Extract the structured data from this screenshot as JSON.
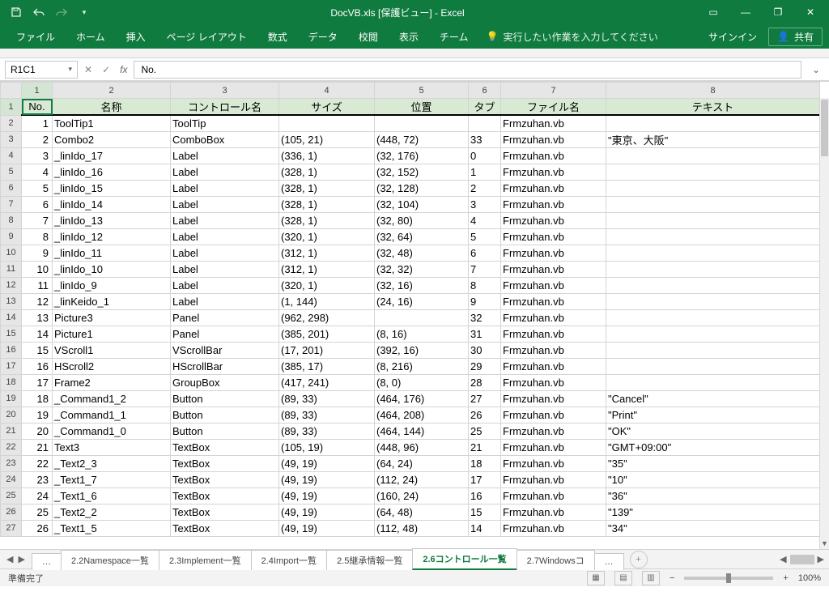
{
  "title": "DocVB.xls  [保護ビュー] - Excel",
  "qat": {
    "save": "save-icon",
    "undo": "undo-icon",
    "redo": "redo-icon",
    "customize": "▾"
  },
  "win": {
    "ribbon_opts": "▭",
    "min": "—",
    "restore": "❐",
    "close": "✕"
  },
  "ribbon": {
    "tabs": [
      "ファイル",
      "ホーム",
      "挿入",
      "ページ レイアウト",
      "数式",
      "データ",
      "校閲",
      "表示",
      "チーム"
    ],
    "tell_me": "実行したい作業を入力してください",
    "signin": "サインイン",
    "share": "共有"
  },
  "namebox": "R1C1",
  "formula": "No.",
  "columns": {
    "letters": [
      "1",
      "2",
      "3",
      "4",
      "5",
      "6",
      "7",
      "8"
    ],
    "headers": [
      "No.",
      "名称",
      "コントロール名",
      "サイズ",
      "位置",
      "タブ",
      "ファイル名",
      "テキスト"
    ]
  },
  "rows": [
    {
      "r": 2,
      "no": "1",
      "name": "ToolTip1",
      "ctrl": "ToolTip",
      "size": "",
      "pos": "",
      "tab": "",
      "file": "Frmzuhan.vb",
      "text": ""
    },
    {
      "r": 3,
      "no": "2",
      "name": "Combo2",
      "ctrl": "ComboBox",
      "size": "(105, 21)",
      "pos": "(448, 72)",
      "tab": "33",
      "file": "Frmzuhan.vb",
      "text": "\"東京、大阪\""
    },
    {
      "r": 4,
      "no": "3",
      "name": "_linIdo_17",
      "ctrl": "Label",
      "size": "(336, 1)",
      "pos": "(32, 176)",
      "tab": "0",
      "file": "Frmzuhan.vb",
      "text": ""
    },
    {
      "r": 5,
      "no": "4",
      "name": "_linIdo_16",
      "ctrl": "Label",
      "size": "(328, 1)",
      "pos": "(32, 152)",
      "tab": "1",
      "file": "Frmzuhan.vb",
      "text": ""
    },
    {
      "r": 6,
      "no": "5",
      "name": "_linIdo_15",
      "ctrl": "Label",
      "size": "(328, 1)",
      "pos": "(32, 128)",
      "tab": "2",
      "file": "Frmzuhan.vb",
      "text": ""
    },
    {
      "r": 7,
      "no": "6",
      "name": "_linIdo_14",
      "ctrl": "Label",
      "size": "(328, 1)",
      "pos": "(32, 104)",
      "tab": "3",
      "file": "Frmzuhan.vb",
      "text": ""
    },
    {
      "r": 8,
      "no": "7",
      "name": "_linIdo_13",
      "ctrl": "Label",
      "size": "(328, 1)",
      "pos": "(32, 80)",
      "tab": "4",
      "file": "Frmzuhan.vb",
      "text": ""
    },
    {
      "r": 9,
      "no": "8",
      "name": "_linIdo_12",
      "ctrl": "Label",
      "size": "(320, 1)",
      "pos": "(32, 64)",
      "tab": "5",
      "file": "Frmzuhan.vb",
      "text": ""
    },
    {
      "r": 10,
      "no": "9",
      "name": "_linIdo_11",
      "ctrl": "Label",
      "size": "(312, 1)",
      "pos": "(32, 48)",
      "tab": "6",
      "file": "Frmzuhan.vb",
      "text": ""
    },
    {
      "r": 11,
      "no": "10",
      "name": "_linIdo_10",
      "ctrl": "Label",
      "size": "(312, 1)",
      "pos": "(32, 32)",
      "tab": "7",
      "file": "Frmzuhan.vb",
      "text": ""
    },
    {
      "r": 12,
      "no": "11",
      "name": "_linIdo_9",
      "ctrl": "Label",
      "size": "(320, 1)",
      "pos": "(32, 16)",
      "tab": "8",
      "file": "Frmzuhan.vb",
      "text": ""
    },
    {
      "r": 13,
      "no": "12",
      "name": "_linKeido_1",
      "ctrl": "Label",
      "size": "(1, 144)",
      "pos": "(24, 16)",
      "tab": "9",
      "file": "Frmzuhan.vb",
      "text": ""
    },
    {
      "r": 14,
      "no": "13",
      "name": "Picture3",
      "ctrl": "Panel",
      "size": "(962, 298)",
      "pos": "",
      "tab": "32",
      "file": "Frmzuhan.vb",
      "text": ""
    },
    {
      "r": 15,
      "no": "14",
      "name": "Picture1",
      "ctrl": "Panel",
      "size": "(385, 201)",
      "pos": "(8, 16)",
      "tab": "31",
      "file": "Frmzuhan.vb",
      "text": ""
    },
    {
      "r": 16,
      "no": "15",
      "name": "VScroll1",
      "ctrl": "VScrollBar",
      "size": "(17, 201)",
      "pos": "(392, 16)",
      "tab": "30",
      "file": "Frmzuhan.vb",
      "text": ""
    },
    {
      "r": 17,
      "no": "16",
      "name": "HScroll2",
      "ctrl": "HScrollBar",
      "size": "(385, 17)",
      "pos": "(8, 216)",
      "tab": "29",
      "file": "Frmzuhan.vb",
      "text": ""
    },
    {
      "r": 18,
      "no": "17",
      "name": "Frame2",
      "ctrl": "GroupBox",
      "size": "(417, 241)",
      "pos": "(8, 0)",
      "tab": "28",
      "file": "Frmzuhan.vb",
      "text": ""
    },
    {
      "r": 19,
      "no": "18",
      "name": "_Command1_2",
      "ctrl": "Button",
      "size": "(89, 33)",
      "pos": "(464, 176)",
      "tab": "27",
      "file": "Frmzuhan.vb",
      "text": "\"Cancel\""
    },
    {
      "r": 20,
      "no": "19",
      "name": "_Command1_1",
      "ctrl": "Button",
      "size": "(89, 33)",
      "pos": "(464, 208)",
      "tab": "26",
      "file": "Frmzuhan.vb",
      "text": "\"Print\""
    },
    {
      "r": 21,
      "no": "20",
      "name": "_Command1_0",
      "ctrl": "Button",
      "size": "(89, 33)",
      "pos": "(464, 144)",
      "tab": "25",
      "file": "Frmzuhan.vb",
      "text": "\"OK\""
    },
    {
      "r": 22,
      "no": "21",
      "name": "Text3",
      "ctrl": "TextBox",
      "size": "(105, 19)",
      "pos": "(448, 96)",
      "tab": "21",
      "file": "Frmzuhan.vb",
      "text": "\"GMT+09:00\""
    },
    {
      "r": 23,
      "no": "22",
      "name": "_Text2_3",
      "ctrl": "TextBox",
      "size": "(49, 19)",
      "pos": "(64, 24)",
      "tab": "18",
      "file": "Frmzuhan.vb",
      "text": "\"35\""
    },
    {
      "r": 24,
      "no": "23",
      "name": "_Text1_7",
      "ctrl": "TextBox",
      "size": "(49, 19)",
      "pos": "(112, 24)",
      "tab": "17",
      "file": "Frmzuhan.vb",
      "text": "\"10\""
    },
    {
      "r": 25,
      "no": "24",
      "name": "_Text1_6",
      "ctrl": "TextBox",
      "size": "(49, 19)",
      "pos": "(160, 24)",
      "tab": "16",
      "file": "Frmzuhan.vb",
      "text": "\"36\""
    },
    {
      "r": 26,
      "no": "25",
      "name": "_Text2_2",
      "ctrl": "TextBox",
      "size": "(49, 19)",
      "pos": "(64, 48)",
      "tab": "15",
      "file": "Frmzuhan.vb",
      "text": "\"139\""
    },
    {
      "r": 27,
      "no": "26",
      "name": "_Text1_5",
      "ctrl": "TextBox",
      "size": "(49, 19)",
      "pos": "(112, 48)",
      "tab": "14",
      "file": "Frmzuhan.vb",
      "text": "\"34\""
    }
  ],
  "sheet_tabs": {
    "items": [
      "…",
      "2.2Namespace一覧",
      "2.3Implement一覧",
      "2.4Import一覧",
      "2.5継承情報一覧",
      "2.6コントロール一覧",
      "2.7Windowsコ",
      "…"
    ],
    "active": 5
  },
  "status": {
    "left": "準備完了",
    "zoom": "100%",
    "minus": "−",
    "plus": "+"
  }
}
